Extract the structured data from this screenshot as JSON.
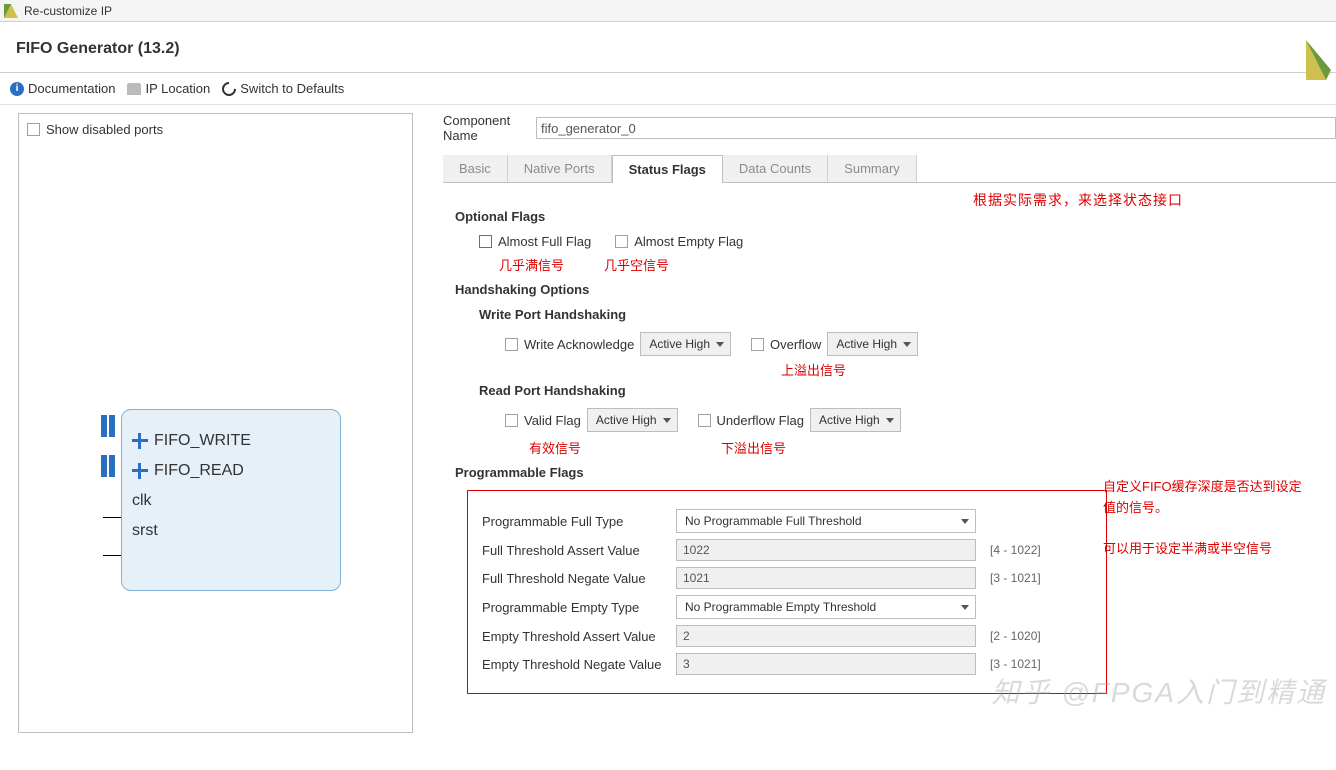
{
  "window": {
    "title": "Re-customize IP"
  },
  "header": {
    "title": "FIFO Generator (13.2)"
  },
  "toolbar": {
    "documentation": "Documentation",
    "ip_location": "IP Location",
    "switch_defaults": "Switch to Defaults"
  },
  "left": {
    "show_disabled": "Show disabled ports",
    "block": {
      "fifo_write": "FIFO_WRITE",
      "fifo_read": "FIFO_READ",
      "clk": "clk",
      "srst": "srst"
    }
  },
  "component": {
    "label": "Component Name",
    "value": "fifo_generator_0"
  },
  "tabs": [
    "Basic",
    "Native Ports",
    "Status Flags",
    "Data Counts",
    "Summary"
  ],
  "annotations": {
    "top": "根据实际需求，来选择状态接口",
    "almost_full": "几乎满信号",
    "almost_empty": "几乎空信号",
    "overflow": "上溢出信号",
    "valid": "有效信号",
    "underflow": "下溢出信号",
    "side": "自定义FIFO缓存深度是否达到设定值的信号。\n\n可以用于设定半满或半空信号"
  },
  "sections": {
    "optional": "Optional Flags",
    "almost_full_flag": "Almost Full Flag",
    "almost_empty_flag": "Almost Empty Flag",
    "handshaking": "Handshaking Options",
    "write_port": "Write Port Handshaking",
    "write_ack": "Write Acknowledge",
    "overflow": "Overflow",
    "read_port": "Read Port Handshaking",
    "valid_flag": "Valid Flag",
    "underflow_flag": "Underflow Flag",
    "programmable": "Programmable Flags",
    "active_high": "Active High",
    "prog": {
      "full_type_label": "Programmable Full Type",
      "full_type_value": "No Programmable Full Threshold",
      "full_assert_label": "Full Threshold Assert Value",
      "full_assert_value": "1022",
      "full_assert_range": "[4 - 1022]",
      "full_negate_label": "Full Threshold Negate Value",
      "full_negate_value": "1021",
      "full_negate_range": "[3 - 1021]",
      "empty_type_label": "Programmable Empty Type",
      "empty_type_value": "No Programmable Empty Threshold",
      "empty_assert_label": "Empty Threshold Assert Value",
      "empty_assert_value": "2",
      "empty_assert_range": "[2 - 1020]",
      "empty_negate_label": "Empty Threshold Negate Value",
      "empty_negate_value": "3",
      "empty_negate_range": "[3 - 1021]"
    }
  },
  "watermark": "知乎 @FPGA入门到精通"
}
